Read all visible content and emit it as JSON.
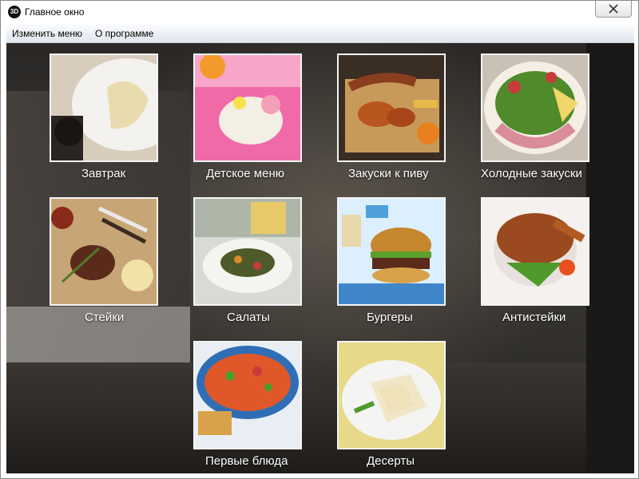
{
  "window": {
    "title": "Главное окно",
    "icon_text": "3D"
  },
  "menu": {
    "items": [
      "Изменить меню",
      "О программе"
    ]
  },
  "categories": [
    {
      "label": "Завтрак",
      "icon": "breakfast-image"
    },
    {
      "label": "Детское меню",
      "icon": "kids-menu-image"
    },
    {
      "label": "Закуски к пиву",
      "icon": "beer-snacks-image"
    },
    {
      "label": "Холодные закуски",
      "icon": "cold-appetizers-image"
    },
    {
      "label": "Стейки",
      "icon": "steaks-image"
    },
    {
      "label": "Салаты",
      "icon": "salads-image"
    },
    {
      "label": "Бургеры",
      "icon": "burgers-image"
    },
    {
      "label": "Антистейки",
      "icon": "antisteaks-image"
    },
    {
      "label": "Первые блюда",
      "icon": "soups-image"
    },
    {
      "label": "Десерты",
      "icon": "desserts-image"
    }
  ]
}
